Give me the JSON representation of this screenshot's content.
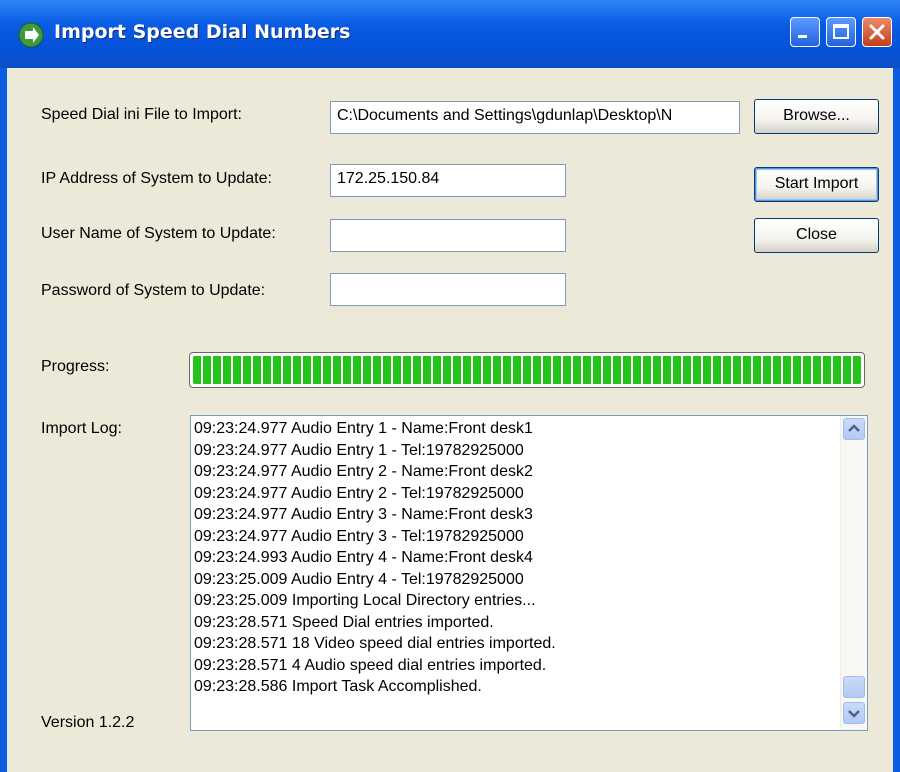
{
  "window": {
    "title": "Import Speed Dial Numbers",
    "title_icon": "arrow-icon"
  },
  "form": {
    "file_label": "Speed Dial ini File to Import:",
    "file_value": "C:\\Documents and Settings\\gdunlap\\Desktop\\N",
    "ip_label": "IP Address of System to Update:",
    "ip_value": "172.25.150.84",
    "username_label": "User Name of System to Update:",
    "username_value": "",
    "password_label": "Password of System to Update:",
    "password_value": ""
  },
  "buttons": {
    "browse": "Browse...",
    "start_import": "Start Import",
    "close": "Close"
  },
  "progress": {
    "label": "Progress:",
    "value": 1.0
  },
  "log": {
    "label": "Import Log:",
    "lines": [
      "09:23:24.977  Audio Entry 1 - Name:Front desk1",
      "09:23:24.977  Audio Entry 1 - Tel:19782925000",
      "09:23:24.977  Audio Entry 2 - Name:Front desk2",
      "09:23:24.977  Audio Entry 2 - Tel:19782925000",
      "09:23:24.977  Audio Entry 3 - Name:Front desk3",
      "09:23:24.977  Audio Entry 3 - Tel:19782925000",
      "09:23:24.993  Audio Entry 4 - Name:Front desk4",
      "09:23:25.009  Audio Entry 4 - Tel:19782925000",
      "09:23:25.009  Importing Local Directory entries...",
      "09:23:28.571  Speed Dial entries imported.",
      "09:23:28.571  18 Video speed dial entries imported.",
      "09:23:28.571  4 Audio speed dial entries imported.",
      "09:23:28.586  Import Task Accomplished."
    ]
  },
  "version": "Version 1.2.2",
  "colors": {
    "titlebar": "#0a5ce4",
    "client_bg": "#ece9d8",
    "progress_fill": "#25c41d",
    "close_button": "#c63d1b"
  }
}
